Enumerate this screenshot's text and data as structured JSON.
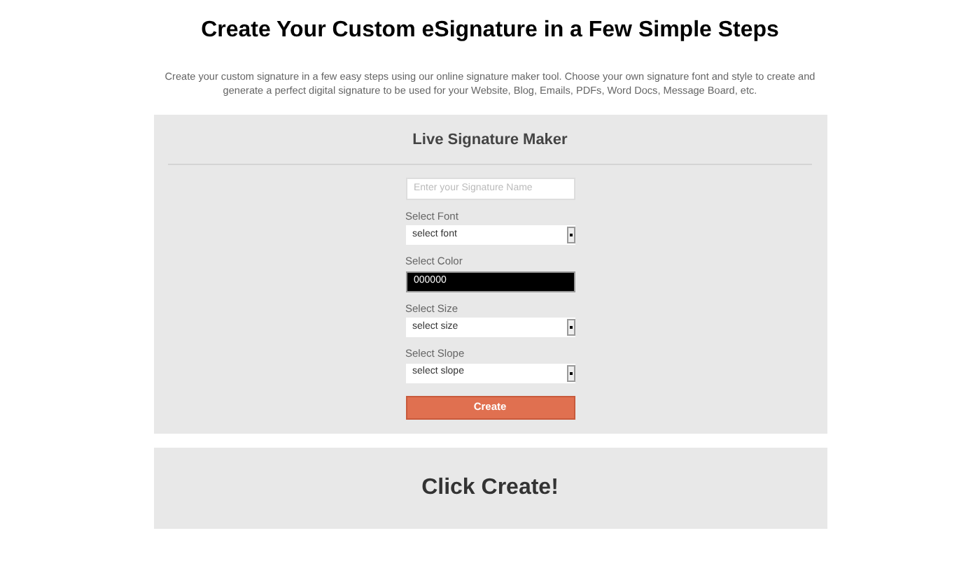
{
  "title": "Create Your Custom eSignature in a Few Simple Steps",
  "description": "Create your custom signature in a few easy steps using our online signature maker tool. Choose your own signature font and style to create and generate a perfect digital signature to be used for your Website, Blog, Emails, PDFs, Word Docs, Message Board, etc.",
  "maker": {
    "title": "Live Signature Maker",
    "fields": [
      {
        "kind": "text",
        "placeholder": "Enter your Signature Name"
      },
      {
        "kind": "select",
        "label": "Select Font",
        "value": "select font"
      },
      {
        "kind": "color",
        "label": "Select Color",
        "value": "000000",
        "color": "#000000"
      },
      {
        "kind": "select",
        "label": "Select Size",
        "value": "select size"
      },
      {
        "kind": "select",
        "label": "Select Slope",
        "value": "select slope"
      }
    ],
    "button": "Create"
  },
  "result": {
    "text": "Click Create!"
  }
}
